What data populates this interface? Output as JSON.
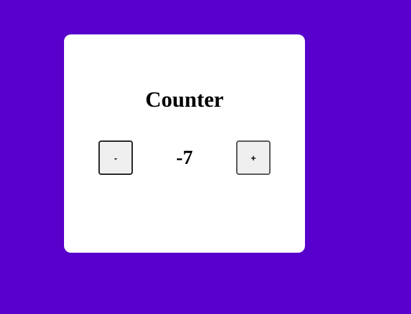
{
  "colors": {
    "background": "#5800CC",
    "card": "#FFFFFF"
  },
  "counter": {
    "title": "Counter",
    "value": "-7",
    "decrement_label": "-",
    "increment_label": "+"
  }
}
